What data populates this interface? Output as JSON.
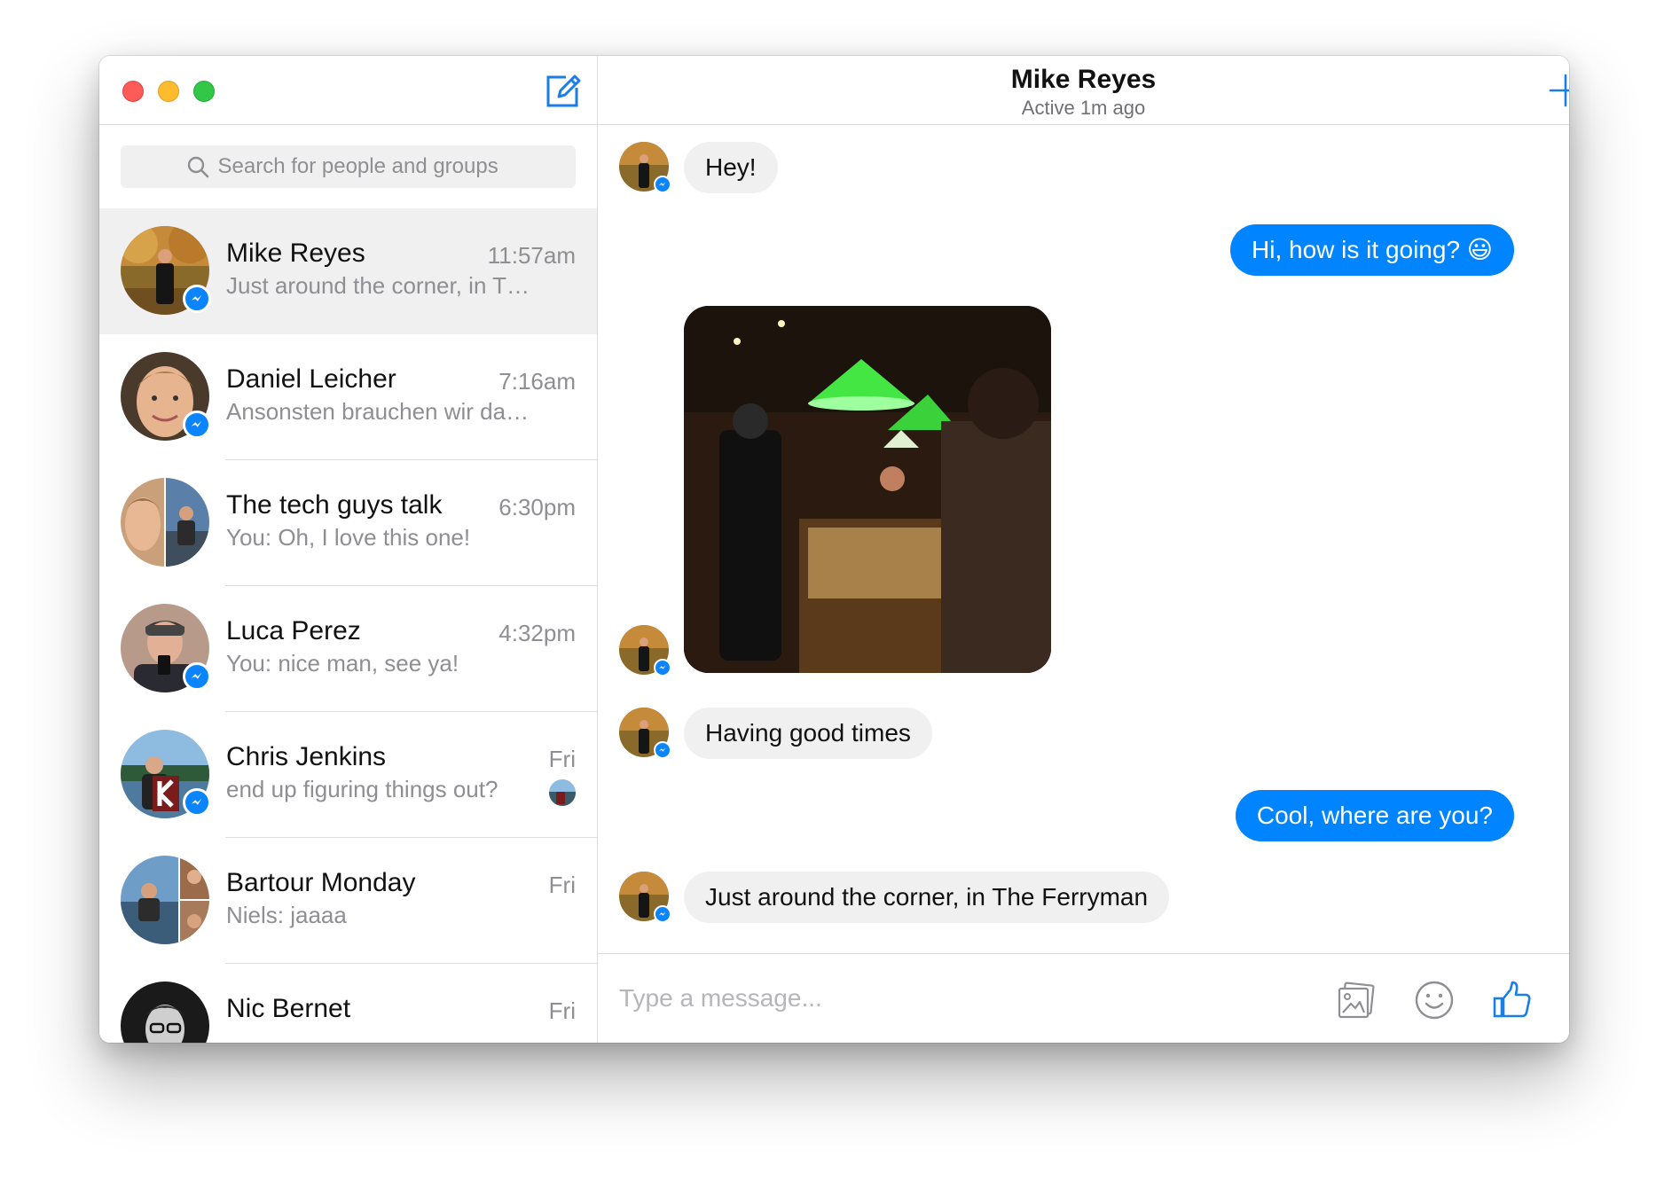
{
  "search": {
    "placeholder": "Search for people and groups"
  },
  "conversations": [
    {
      "name": "Mike Reyes",
      "time": "11:57am",
      "preview": "Just around the corner, in T…",
      "active": true
    },
    {
      "name": "Daniel Leicher",
      "time": "7:16am",
      "preview": "Ansonsten brauchen wir dann …"
    },
    {
      "name": "The tech guys talk",
      "time": "6:30pm",
      "preview": "You: Oh, I love this one!"
    },
    {
      "name": "Luca Perez",
      "time": "4:32pm",
      "preview": "You: nice man, see ya!"
    },
    {
      "name": "Chris Jenkins",
      "time": "Fri",
      "preview": "end up figuring things out?"
    },
    {
      "name": "Bartour Monday",
      "time": "Fri",
      "preview": "Niels: jaaaa"
    },
    {
      "name": "Nic Bernet",
      "time": "Fri",
      "preview": ""
    }
  ],
  "chat": {
    "title": "Mike Reyes",
    "status": "Active 1m ago",
    "messages": [
      {
        "from": "them",
        "text": "Hey!"
      },
      {
        "from": "me",
        "text": "Hi, how is it going? 😃"
      },
      {
        "from": "them",
        "type": "photo"
      },
      {
        "from": "them",
        "text": "Having good times"
      },
      {
        "from": "me",
        "text": "Cool, where are you?"
      },
      {
        "from": "them",
        "text": "Just around the corner, in The Ferryman"
      }
    ]
  },
  "composer": {
    "placeholder": "Type a message..."
  },
  "icons": {
    "header": [
      "compose-icon",
      "add-icon",
      "info-icon"
    ],
    "composer": [
      "photo-icon",
      "emoji-icon",
      "like-icon"
    ]
  },
  "colors": {
    "accent": "#0084ff",
    "incoming_bubble": "#f1f0f0",
    "close": "#fc5b57",
    "minimize": "#fdbc2e",
    "zoom": "#33c748"
  }
}
